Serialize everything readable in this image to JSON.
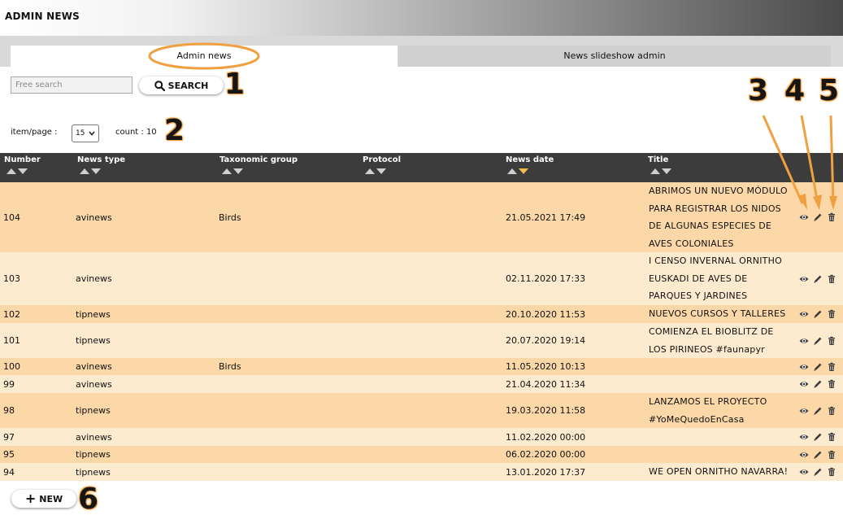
{
  "header": {
    "title": "ADMIN NEWS"
  },
  "tabs": [
    {
      "label": "Admin news",
      "active": true
    },
    {
      "label": "News slideshow admin",
      "active": false
    }
  ],
  "search": {
    "placeholder": "Free search",
    "value": "",
    "button_label": "SEARCH"
  },
  "paging": {
    "items_per_page_label": "item/page :",
    "items_per_page_value": "15",
    "count_text": "count : 10"
  },
  "callouts": [
    "1",
    "2",
    "3",
    "4",
    "5",
    "6"
  ],
  "table": {
    "columns": [
      "Number",
      "News type",
      "Taxonomic group",
      "Protocol",
      "News date",
      "Title"
    ],
    "active_sort": "News date (descending)",
    "rows": [
      {
        "number": "104",
        "type": "avinews",
        "taxonomic_group": "Birds",
        "protocol": "",
        "date": "21.05.2021 17:49",
        "title": "ABRIMOS UN NUEVO MÓDULO PARA REGISTRAR LOS NIDOS DE ALGUNAS ESPECIES DE AVES COLONIALES"
      },
      {
        "number": "103",
        "type": "avinews",
        "taxonomic_group": "",
        "protocol": "",
        "date": "02.11.2020 17:33",
        "title": "I CENSO INVERNAL ORNITHO EUSKADI DE AVES DE PARQUES Y JARDINES"
      },
      {
        "number": "102",
        "type": "tipnews",
        "taxonomic_group": "",
        "protocol": "",
        "date": "20.10.2020 11:53",
        "title": "NUEVOS CURSOS Y TALLERES"
      },
      {
        "number": "101",
        "type": "tipnews",
        "taxonomic_group": "",
        "protocol": "",
        "date": "20.07.2020 19:14",
        "title": "COMIENZA EL BIOBLITZ DE LOS PIRINEOS #faunapyr"
      },
      {
        "number": "100",
        "type": "avinews",
        "taxonomic_group": "Birds",
        "protocol": "",
        "date": "11.05.2020 10:13",
        "title": ""
      },
      {
        "number": "99",
        "type": "avinews",
        "taxonomic_group": "",
        "protocol": "",
        "date": "21.04.2020 11:34",
        "title": ""
      },
      {
        "number": "98",
        "type": "tipnews",
        "taxonomic_group": "",
        "protocol": "",
        "date": "19.03.2020 11:58",
        "title": "LANZAMOS EL PROYECTO #YoMeQuedoEnCasa"
      },
      {
        "number": "97",
        "type": "avinews",
        "taxonomic_group": "",
        "protocol": "",
        "date": "11.02.2020 00:00",
        "title": ""
      },
      {
        "number": "95",
        "type": "tipnews",
        "taxonomic_group": "",
        "protocol": "",
        "date": "06.02.2020 00:00",
        "title": ""
      },
      {
        "number": "94",
        "type": "tipnews",
        "taxonomic_group": "",
        "protocol": "",
        "date": "13.01.2020 17:37",
        "title": "WE OPEN ORNITHO NAVARRA!"
      }
    ],
    "row_actions": [
      "eye-icon",
      "pencil-icon",
      "trash-icon"
    ]
  },
  "new_button": {
    "label": "NEW"
  },
  "colors": {
    "row_odd": "#fcd8a8",
    "row_even": "#fdebd0",
    "header_bg": "#3c3c3c",
    "callout_orange": "#f0a040",
    "sort_active": "#f4b94a"
  }
}
